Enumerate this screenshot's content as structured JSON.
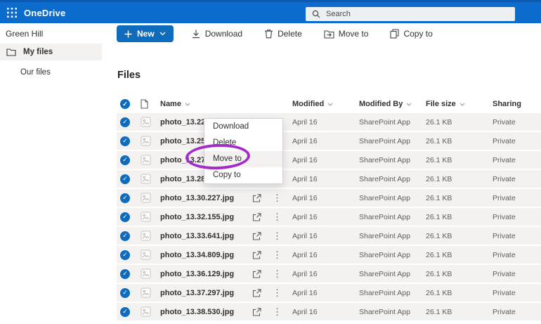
{
  "topbar": {
    "app_title": "OneDrive",
    "search": {
      "placeholder": "Search"
    }
  },
  "site": {
    "name": "Green Hill"
  },
  "toolbar": {
    "new_button": {
      "label": "New"
    },
    "buttons": [
      {
        "label": "Download"
      },
      {
        "label": "Delete"
      },
      {
        "label": "Move to"
      },
      {
        "label": "Copy to"
      }
    ]
  },
  "sidebar": {
    "items": [
      {
        "label": "My files",
        "selected": true
      },
      {
        "label": "Our files",
        "selected": false
      }
    ]
  },
  "main": {
    "title": "Files",
    "table": {
      "headers": {
        "name": "Name",
        "modified": "Modified",
        "modified_by": "Modified By",
        "file_size": "File size",
        "sharing": "Sharing"
      },
      "rows": [
        {
          "name": "photo_13.22.44",
          "modified": "April 16",
          "modified_by": "SharePoint App",
          "size": "26.1 KB",
          "sharing": "Private"
        },
        {
          "name": "photo_13.25.679",
          "modified": "April 16",
          "modified_by": "SharePoint App",
          "size": "26.1 KB",
          "sharing": "Private"
        },
        {
          "name": "photo_13.27.3",
          "modified": "April 16",
          "modified_by": "SharePoint App",
          "size": "26.1 KB",
          "sharing": "Private"
        },
        {
          "name": "photo_13.28.889",
          "modified": "April 16",
          "modified_by": "SharePoint App",
          "size": "26.1 KB",
          "sharing": "Private"
        },
        {
          "name": "photo_13.30.227.jpg",
          "modified": "April 16",
          "modified_by": "SharePoint App",
          "size": "26.1 KB",
          "sharing": "Private"
        },
        {
          "name": "photo_13.32.155.jpg",
          "modified": "April 16",
          "modified_by": "SharePoint App",
          "size": "26.1 KB",
          "sharing": "Private"
        },
        {
          "name": "photo_13.33.641.jpg",
          "modified": "April 16",
          "modified_by": "SharePoint App",
          "size": "26.1 KB",
          "sharing": "Private"
        },
        {
          "name": "photo_13.34.809.jpg",
          "modified": "April 16",
          "modified_by": "SharePoint App",
          "size": "26.1 KB",
          "sharing": "Private"
        },
        {
          "name": "photo_13.36.129.jpg",
          "modified": "April 16",
          "modified_by": "SharePoint App",
          "size": "26.1 KB",
          "sharing": "Private"
        },
        {
          "name": "photo_13.37.297.jpg",
          "modified": "April 16",
          "modified_by": "SharePoint App",
          "size": "26.1 KB",
          "sharing": "Private"
        },
        {
          "name": "photo_13.38.530.jpg",
          "modified": "April 16",
          "modified_by": "SharePoint App",
          "size": "26.1 KB",
          "sharing": "Private"
        }
      ]
    }
  },
  "context_menu": {
    "items": [
      "Download",
      "Delete",
      "Move to",
      "Copy to"
    ],
    "highlighted_item": "Move to"
  },
  "annotation": {
    "type": "ellipse",
    "around": "Move to",
    "color": "#a42cc8"
  },
  "colors": {
    "topbar_blue": "#0c6ccd",
    "accent_blue": "#0f6cbd",
    "selected_row_bg": "#f3f2f1",
    "annotation_purple": "#a42cc8"
  }
}
